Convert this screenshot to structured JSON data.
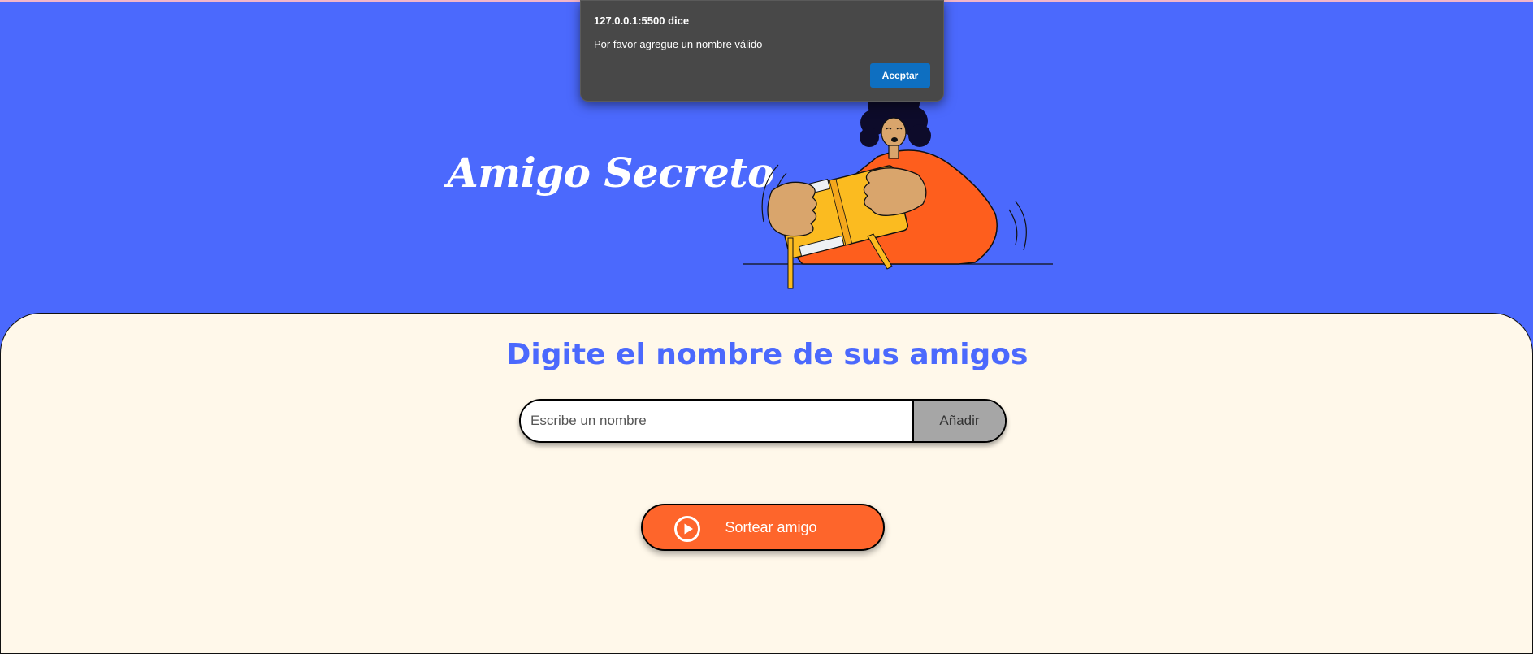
{
  "header": {
    "title": "Amigo Secreto",
    "illustration": "person-holding-gift"
  },
  "main": {
    "subtitle": "Digite el nombre de sus amigos",
    "name_input": {
      "placeholder": "Escribe un nombre",
      "value": ""
    },
    "add_label": "Añadir",
    "draw_label": "Sortear amigo",
    "draw_icon": "play-circle-icon"
  },
  "dialog": {
    "title": "127.0.0.1:5500 dice",
    "message": "Por favor agregue un nombre válido",
    "ok_label": "Aceptar"
  },
  "colors": {
    "primary": "#4b69fd",
    "background": "#fff8ea",
    "accent": "#fe652b",
    "add_button": "#a6a6a6",
    "dialog_button": "#0e6fc1"
  }
}
